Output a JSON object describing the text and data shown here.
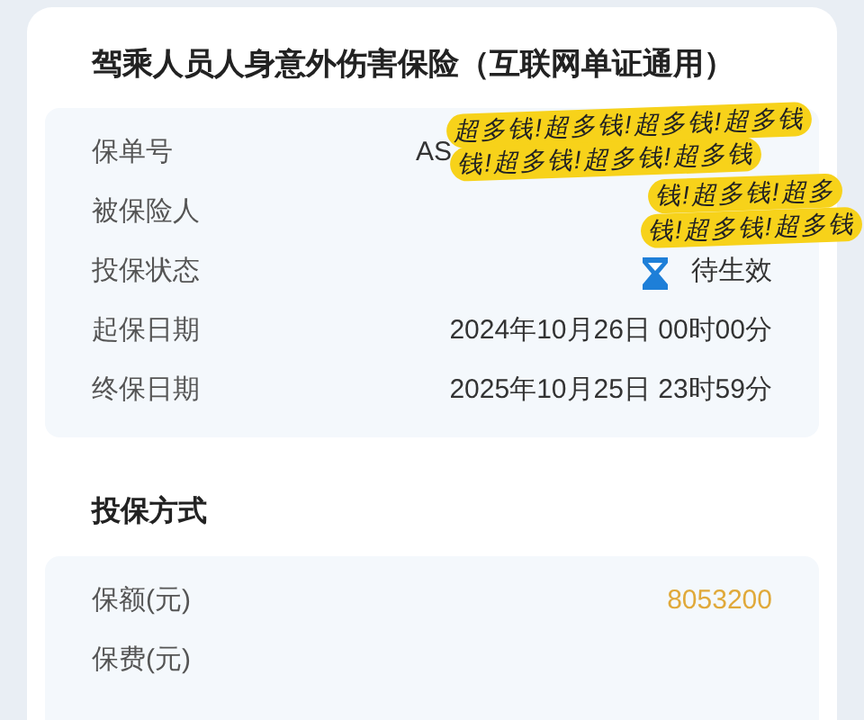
{
  "policy": {
    "title": "驾乘人员人身意外伤害保险（互联网单证通用）",
    "rows": [
      {
        "label": "保单号",
        "kind": "partial",
        "value": "AS"
      },
      {
        "label": "被保险人",
        "kind": "blank"
      },
      {
        "label": "投保状态",
        "kind": "status",
        "value": "待生效"
      },
      {
        "label": "起保日期",
        "kind": "text",
        "value": "2024年10月26日 00时00分"
      },
      {
        "label": "终保日期",
        "kind": "text",
        "value": "2025年10月25日 23时59分"
      }
    ]
  },
  "method": {
    "title": "投保方式",
    "rows": [
      {
        "label": "保额(元)",
        "kind": "amount",
        "value": "8053200"
      },
      {
        "label": "保费(元)",
        "kind": "blank"
      }
    ]
  },
  "sticker": {
    "lines": [
      "超多钱!超多钱!超多钱!超多钱",
      "钱!超多钱!超多钱!超多钱",
      "钱!超多钱!超多",
      "钱!超多钱!超多钱"
    ]
  }
}
